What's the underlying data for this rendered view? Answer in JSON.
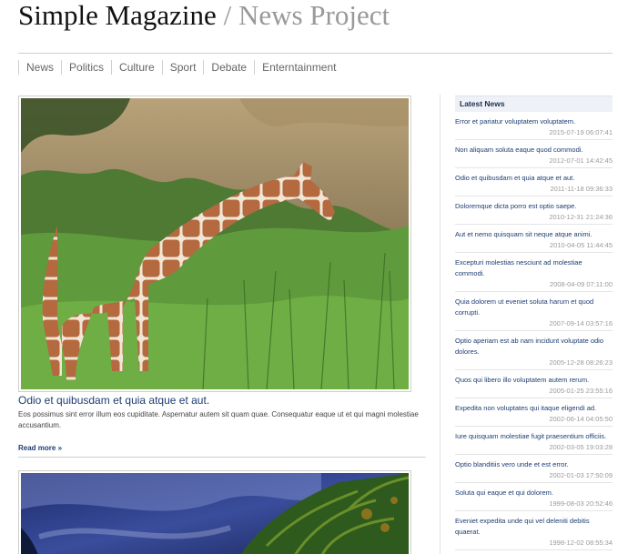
{
  "header": {
    "title_main": "Simple Magazine",
    "title_sep": " / ",
    "title_sub": "News Project"
  },
  "nav": [
    "News",
    "Politics",
    "Culture",
    "Sport",
    "Debate",
    "Enterntainment"
  ],
  "articles": [
    {
      "title": "Odio et quibusdam et quia atque et aut.",
      "summary": "Eos possimus sint error illum eos cupiditate. Aspernatur autem sit quam quae. Consequatur eaque ut et qui magni molestiae accusantium.",
      "read_more": "Read more »"
    }
  ],
  "sidebar": {
    "header": "Latest News",
    "items": [
      {
        "title": "Error et pariatur voluptatem voluptatem.",
        "date": "2015-07-19 06:07:41"
      },
      {
        "title": "Non aliquam soluta eaque quod commodi.",
        "date": "2012-07-01 14:42:45"
      },
      {
        "title": "Odio et quibusdam et quia atque et aut.",
        "date": "2011-11-18 09:36:33"
      },
      {
        "title": "Doloremque dicta porro est optio saepe.",
        "date": "2010-12-31 21:24:36"
      },
      {
        "title": "Aut et nemo quisquam sit neque atque animi.",
        "date": "2010-04-05 11:44:45"
      },
      {
        "title": "Excepturi molestias nesciunt ad molestiae commodi.",
        "date": "2008-04-09 07:11:00"
      },
      {
        "title": "Quia dolorem ut eveniet soluta harum et quod corrupti.",
        "date": "2007-09-14 03:57:16"
      },
      {
        "title": "Optio aperiam est ab nam incidunt voluptate odio dolores.",
        "date": "2005-12-28 08:26:23"
      },
      {
        "title": "Quos qui libero illo voluptatem autem rerum.",
        "date": "2005-01-25 23:55:16"
      },
      {
        "title": "Expedita non voluptates qui itaque eligendi ad.",
        "date": "2002-06-14 04:05:50"
      },
      {
        "title": "Iure quisquam molestiae fugit praesentium officiis.",
        "date": "2002-03-05 19:03:28"
      },
      {
        "title": "Optio blanditiis vero unde et est error.",
        "date": "2002-01-03 17:50:09"
      },
      {
        "title": "Soluta qui eaque et qui dolorem.",
        "date": "1999-08-03 20:52:46"
      },
      {
        "title": "Eveniet expedita unde qui vel deleniti debitis quaerat.",
        "date": "1998-12-02 08:55:34"
      }
    ]
  }
}
